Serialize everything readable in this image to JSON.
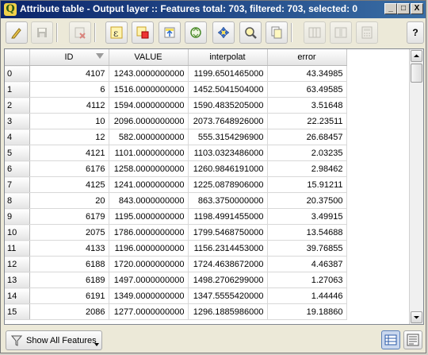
{
  "window": {
    "app_icon_letter": "Q",
    "title": "Attribute table - Output layer :: Features total: 703, filtered: 703, selected: 0",
    "minimize_label": "_",
    "maximize_label": "□",
    "close_label": "X"
  },
  "toolbar": {
    "help_label": "?",
    "buttons": [
      {
        "name": "toggle-editing-icon",
        "enabled": true
      },
      {
        "name": "save-edits-icon",
        "enabled": false
      },
      {
        "name": "delete-selected-icon",
        "enabled": false
      },
      {
        "name": "select-by-expression-icon",
        "enabled": true
      },
      {
        "name": "unselect-all-icon",
        "enabled": true
      },
      {
        "name": "move-selection-to-top-icon",
        "enabled": true
      },
      {
        "name": "invert-selection-icon",
        "enabled": true
      },
      {
        "name": "pan-map-to-selected-icon",
        "enabled": true
      },
      {
        "name": "zoom-map-to-selected-icon",
        "enabled": true
      },
      {
        "name": "copy-selected-rows-icon",
        "enabled": true
      },
      {
        "name": "new-column-icon",
        "enabled": false
      },
      {
        "name": "delete-column-icon",
        "enabled": false
      },
      {
        "name": "field-calculator-icon",
        "enabled": false
      }
    ]
  },
  "table": {
    "columns": [
      "ID",
      "VALUE",
      "interpolat",
      "error"
    ],
    "sorted_column": "ID",
    "rows": [
      {
        "row": "0",
        "ID": "4107",
        "VALUE": "1243.0000000000",
        "interpolat": "1199.6501465000",
        "error": "43.34985"
      },
      {
        "row": "1",
        "ID": "6",
        "VALUE": "1516.0000000000",
        "interpolat": "1452.5041504000",
        "error": "63.49585"
      },
      {
        "row": "2",
        "ID": "4112",
        "VALUE": "1594.0000000000",
        "interpolat": "1590.4835205000",
        "error": "3.51648"
      },
      {
        "row": "3",
        "ID": "10",
        "VALUE": "2096.0000000000",
        "interpolat": "2073.7648926000",
        "error": "22.23511"
      },
      {
        "row": "4",
        "ID": "12",
        "VALUE": "582.0000000000",
        "interpolat": "555.3154296900",
        "error": "26.68457"
      },
      {
        "row": "5",
        "ID": "4121",
        "VALUE": "1101.0000000000",
        "interpolat": "1103.0323486000",
        "error": "2.03235"
      },
      {
        "row": "6",
        "ID": "6176",
        "VALUE": "1258.0000000000",
        "interpolat": "1260.9846191000",
        "error": "2.98462"
      },
      {
        "row": "7",
        "ID": "4125",
        "VALUE": "1241.0000000000",
        "interpolat": "1225.0878906000",
        "error": "15.91211"
      },
      {
        "row": "8",
        "ID": "20",
        "VALUE": "843.0000000000",
        "interpolat": "863.3750000000",
        "error": "20.37500"
      },
      {
        "row": "9",
        "ID": "6179",
        "VALUE": "1195.0000000000",
        "interpolat": "1198.4991455000",
        "error": "3.49915"
      },
      {
        "row": "10",
        "ID": "2075",
        "VALUE": "1786.0000000000",
        "interpolat": "1799.5468750000",
        "error": "13.54688"
      },
      {
        "row": "11",
        "ID": "4133",
        "VALUE": "1196.0000000000",
        "interpolat": "1156.2314453000",
        "error": "39.76855"
      },
      {
        "row": "12",
        "ID": "6188",
        "VALUE": "1720.0000000000",
        "interpolat": "1724.4638672000",
        "error": "4.46387"
      },
      {
        "row": "13",
        "ID": "6189",
        "VALUE": "1497.0000000000",
        "interpolat": "1498.2706299000",
        "error": "1.27063"
      },
      {
        "row": "14",
        "ID": "6191",
        "VALUE": "1349.0000000000",
        "interpolat": "1347.5555420000",
        "error": "1.44446"
      },
      {
        "row": "15",
        "ID": "2086",
        "VALUE": "1277.0000000000",
        "interpolat": "1296.1885986000",
        "error": "19.18860"
      }
    ]
  },
  "statusbar": {
    "filter_label": "Show All Features",
    "filter_icon": "filter-icon",
    "table_view_icon": "table-view-icon",
    "form_view_icon": "form-view-icon"
  }
}
